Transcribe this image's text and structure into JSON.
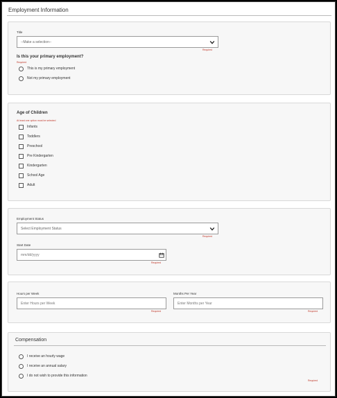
{
  "page": {
    "title": "Employment Information"
  },
  "title_section": {
    "title_label": "Title",
    "title_select_value": "--Make a selection--",
    "title_required": "Required",
    "primary_question": "Is this your primary employment?",
    "primary_required": "Required",
    "primary_options": [
      "This is my primary employment",
      "Not my primary employment"
    ]
  },
  "children_section": {
    "heading": "Age of Children",
    "required_note": "At least one option must be selected",
    "options": [
      "Infants",
      "Toddlers",
      "Preschool",
      "Pre Kindergarten",
      "Kindergarten",
      "School Age",
      "Adult"
    ]
  },
  "status_section": {
    "status_label": "Employment Status",
    "status_select_value": "Select Employment Status",
    "status_required": "Required",
    "start_date_label": "Start Date",
    "start_date_placeholder": "mm/dd/yyyy",
    "start_date_required": "Required"
  },
  "hours_section": {
    "hours_label": "Hours per Week",
    "hours_placeholder": "Enter Hours per Week",
    "hours_required": "Required",
    "months_label": "Months Per Year",
    "months_placeholder": "Enter Months per Year",
    "months_required": "Required"
  },
  "compensation_section": {
    "heading": "Compensation",
    "options": [
      "I receive an hourly wage",
      "I receive an annual salary",
      "I do not wish to provide this information"
    ],
    "required": "Required"
  }
}
